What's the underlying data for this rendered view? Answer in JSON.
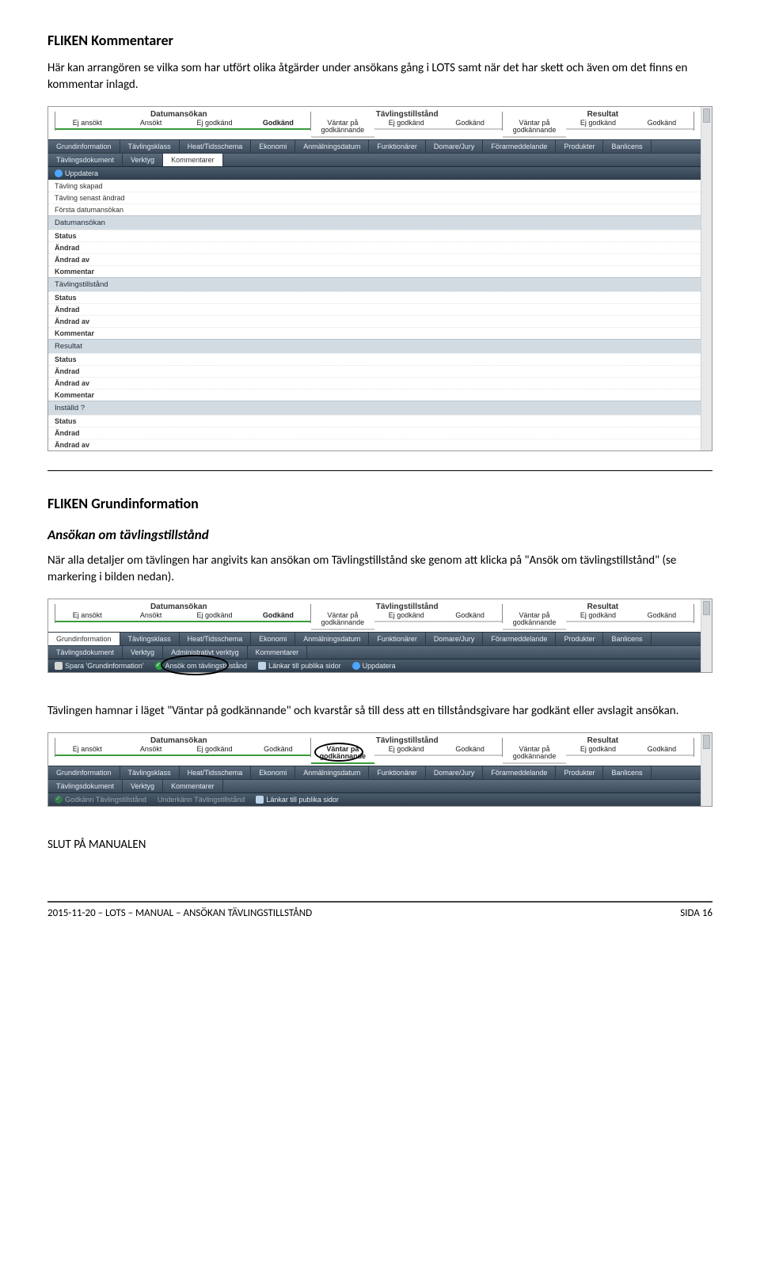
{
  "section1": {
    "title": "FLIKEN Kommentarer",
    "para": "Här kan arrangören se vilka som har utfört olika åtgärder under ansökans gång i LOTS samt när det har skett och även om det finns en kommentar inlagd."
  },
  "progress": {
    "heads": [
      "Datumansökan",
      "Tävlingstillstånd",
      "Resultat"
    ],
    "steps": [
      {
        "label": "Ej ansökt",
        "green": true
      },
      {
        "label": "Ansökt",
        "green": true
      },
      {
        "label": "Ej godkänd",
        "green": true
      },
      {
        "label": "Godkänd",
        "green": true,
        "bold": true
      },
      {
        "label": "Väntar på godkännande",
        "green": false
      },
      {
        "label": "Ej godkänd",
        "green": false
      },
      {
        "label": "Godkänd",
        "green": false
      },
      {
        "label": "Väntar på godkännande",
        "green": false
      },
      {
        "label": "Ej godkänd",
        "green": false
      },
      {
        "label": "Godkänd",
        "green": false
      }
    ]
  },
  "tabs_top": [
    "Grundinformation",
    "Tävlingsklass",
    "Heat/Tidsschema",
    "Ekonomi",
    "Anmälningsdatum",
    "Funktionärer",
    "Domare/Jury",
    "Förarmeddelande",
    "Produkter",
    "Banlicens"
  ],
  "tabs_row2_s1": [
    "Tävlingsdokument",
    "Verktyg",
    "Kommentarer"
  ],
  "tabs_row2_s2": [
    "Tävlingsdokument",
    "Verktyg",
    "Administrativt verktyg",
    "Kommentarer"
  ],
  "tabs_row2_s3": [
    "Tävlingsdokument",
    "Verktyg",
    "Kommentarer"
  ],
  "toolbar_s1": [
    {
      "icon": "blue",
      "label": "Uppdatera"
    }
  ],
  "toolbar_s2": [
    {
      "icon": "save",
      "label": "Spara 'Grundinformation'"
    },
    {
      "icon": "green",
      "label": "Ansök om tävlingstillstånd"
    },
    {
      "icon": "doc",
      "label": "Länkar till publika sidor"
    },
    {
      "icon": "blue",
      "label": "Uppdatera"
    }
  ],
  "toolbar_s3": [
    {
      "icon": "green",
      "label": "Godkänn Tävlingstillstånd",
      "dim": true
    },
    {
      "icon": "",
      "label": "Underkänn Tävlingstillstånd",
      "dim": true
    },
    {
      "icon": "doc",
      "label": "Länkar till publika sidor"
    }
  ],
  "det_rows": [
    {
      "type": "row",
      "label": "Tävling skapad"
    },
    {
      "type": "row",
      "label": "Tävling senast ändrad"
    },
    {
      "type": "row",
      "label": "Första datumansökan"
    },
    {
      "type": "sect",
      "label": "Datumansökan"
    },
    {
      "type": "brow",
      "label": "Status"
    },
    {
      "type": "brow",
      "label": "Ändrad"
    },
    {
      "type": "brow",
      "label": "Ändrad av"
    },
    {
      "type": "brow",
      "label": "Kommentar"
    },
    {
      "type": "sect",
      "label": "Tävlingstillstånd"
    },
    {
      "type": "brow",
      "label": "Status"
    },
    {
      "type": "brow",
      "label": "Ändrad"
    },
    {
      "type": "brow",
      "label": "Ändrad av"
    },
    {
      "type": "brow",
      "label": "Kommentar"
    },
    {
      "type": "sect",
      "label": "Resultat"
    },
    {
      "type": "brow",
      "label": "Status"
    },
    {
      "type": "brow",
      "label": "Ändrad"
    },
    {
      "type": "brow",
      "label": "Ändrad av"
    },
    {
      "type": "brow",
      "label": "Kommentar"
    },
    {
      "type": "sect",
      "label": "Inställd ?"
    },
    {
      "type": "brow",
      "label": "Status"
    },
    {
      "type": "brow",
      "label": "Ändrad"
    },
    {
      "type": "brow",
      "label": "Ändrad av"
    }
  ],
  "section2": {
    "title": "FLIKEN Grundinformation",
    "subtitle": "Ansökan om tävlingstillstånd",
    "para": "När alla detaljer om tävlingen har angivits kan ansökan om Tävlingstillstånd ske genom att klicka på \"Ansök om tävlingstillstånd\" (se markering i bilden nedan)."
  },
  "section3": {
    "para": "Tävlingen hamnar i läget \"Väntar på godkännande\" och kvarstår så till dess att en tillståndsgivare har godkänt eller avslagit ansökan."
  },
  "progress_s3_active": 4,
  "closing": "SLUT PÅ MANUALEN",
  "footer": {
    "left": "2015-11-20 – LOTS – MANUAL – ANSÖKAN TÄVLINGSTILLSTÅND",
    "right": "SIDA 16"
  }
}
